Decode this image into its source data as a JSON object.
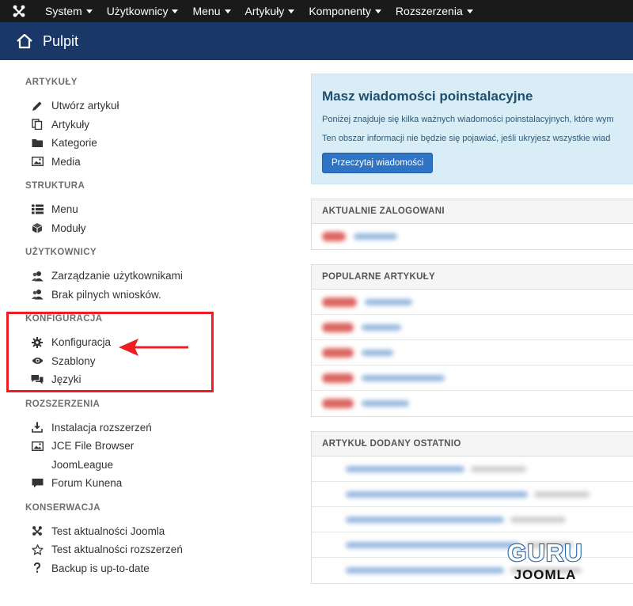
{
  "topnav": {
    "items": [
      "System",
      "Użytkownicy",
      "Menu",
      "Artykuły",
      "Komponenty",
      "Rozszerzenia"
    ]
  },
  "header": {
    "title": "Pulpit"
  },
  "sidebar": {
    "sections": [
      {
        "title": "ARTYKUŁY",
        "items": [
          {
            "label": "Utwórz artykuł",
            "icon": "pencil-icon"
          },
          {
            "label": "Artykuły",
            "icon": "copy-icon"
          },
          {
            "label": "Kategorie",
            "icon": "folder-icon"
          },
          {
            "label": "Media",
            "icon": "image-icon"
          }
        ]
      },
      {
        "title": "STRUKTURA",
        "items": [
          {
            "label": "Menu",
            "icon": "list-icon"
          },
          {
            "label": "Moduły",
            "icon": "cube-icon"
          }
        ]
      },
      {
        "title": "UŻYTKOWNICY",
        "items": [
          {
            "label": "Zarządzanie użytkownikami",
            "icon": "users-icon"
          },
          {
            "label": "Brak pilnych wniosków.",
            "icon": "users-icon"
          }
        ]
      },
      {
        "title": "KONFIGURACJA",
        "items": [
          {
            "label": "Konfiguracja",
            "icon": "gear-icon"
          },
          {
            "label": "Szablony",
            "icon": "eye-icon"
          },
          {
            "label": "Języki",
            "icon": "comments-icon"
          }
        ]
      },
      {
        "title": "ROZSZERZENIA",
        "items": [
          {
            "label": "Instalacja rozszerzeń",
            "icon": "download-icon"
          },
          {
            "label": "JCE File Browser",
            "icon": "image-icon"
          },
          {
            "label": "JoomLeague",
            "icon": ""
          },
          {
            "label": "Forum Kunena",
            "icon": "comment-icon"
          }
        ]
      },
      {
        "title": "KONSERWACJA",
        "items": [
          {
            "label": "Test aktualności Joomla",
            "icon": "joomla-icon"
          },
          {
            "label": "Test aktualności rozszerzeń",
            "icon": "star-icon"
          },
          {
            "label": "Backup is up-to-date",
            "icon": "question-icon"
          }
        ]
      }
    ]
  },
  "alert": {
    "title": "Masz wiadomości poinstalacyjne",
    "line1": "Poniżej znajduje się kilka ważnych wiadomości poinstalacyjnych, które wym",
    "line2": "Ten obszar informacji nie będzie się pojawiać, jeśli ukryjesz wszystkie wiad",
    "button": "Przeczytaj wiadomości"
  },
  "panels": {
    "logged": "AKTUALNIE ZALOGOWANI",
    "popular": "POPULARNE ARTYKUŁY",
    "recent": "ARTYKUŁ DODANY OSTATNIO"
  },
  "watermark": {
    "line1": "GURU",
    "line2": "JOOMLA"
  },
  "colors": {
    "topnav": "#1a1a1a",
    "header": "#1a3867",
    "highlight": "#ef1c24",
    "button": "#2f74c4"
  }
}
